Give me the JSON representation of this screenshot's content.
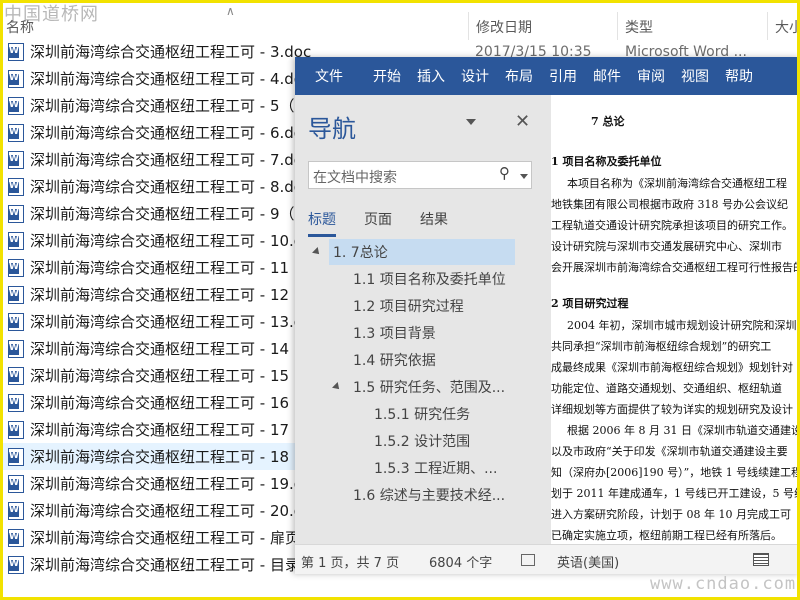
{
  "watermark_top": "中国道桥网",
  "watermark_bottom": "www.cndao.com",
  "explorer": {
    "columns": {
      "name": "名称",
      "date": "修改日期",
      "type": "类型",
      "size": "大小"
    },
    "files": [
      {
        "name": "深圳前海湾综合交通枢纽工程工可 - 3.doc",
        "date": "2017/3/15 10:35",
        "type": "Microsoft Word ..."
      },
      {
        "name": "深圳前海湾综合交通枢纽工程工可 - 4.doc"
      },
      {
        "name": "深圳前海湾综合交通枢纽工程工可 - 5（"
      },
      {
        "name": "深圳前海湾综合交通枢纽工程工可 - 6.doc"
      },
      {
        "name": "深圳前海湾综合交通枢纽工程工可 - 7.doc"
      },
      {
        "name": "深圳前海湾综合交通枢纽工程工可 - 8.doc"
      },
      {
        "name": "深圳前海湾综合交通枢纽工程工可 - 9（"
      },
      {
        "name": "深圳前海湾综合交通枢纽工程工可 - 10.doc"
      },
      {
        "name": "深圳前海湾综合交通枢纽工程工可 - 11"
      },
      {
        "name": "深圳前海湾综合交通枢纽工程工可 - 12"
      },
      {
        "name": "深圳前海湾综合交通枢纽工程工可 - 13.doc"
      },
      {
        "name": "深圳前海湾综合交通枢纽工程工可 - 14"
      },
      {
        "name": "深圳前海湾综合交通枢纽工程工可 - 15"
      },
      {
        "name": "深圳前海湾综合交通枢纽工程工可 - 16"
      },
      {
        "name": "深圳前海湾综合交通枢纽工程工可 - 17"
      },
      {
        "name": "深圳前海湾综合交通枢纽工程工可 - 18（"
      },
      {
        "name": "深圳前海湾综合交通枢纽工程工可 - 19.doc"
      },
      {
        "name": "深圳前海湾综合交通枢纽工程工可 - 20.doc"
      },
      {
        "name": "深圳前海湾综合交通枢纽工程工可 - 扉页"
      },
      {
        "name": "深圳前海湾综合交通枢纽工程工可 - 目录"
      }
    ]
  },
  "word": {
    "ribbon_tabs": [
      "文件",
      "开始",
      "插入",
      "设计",
      "布局",
      "引用",
      "邮件",
      "审阅",
      "视图",
      "帮助"
    ],
    "nav": {
      "title": "导航",
      "search_placeholder": "在文档中搜索",
      "tabs": [
        "标题",
        "页面",
        "结果"
      ],
      "items": [
        {
          "label": "1. 7总论",
          "selected": true,
          "expanded": true
        },
        {
          "label": "1.1 项目名称及委托单位"
        },
        {
          "label": "1.2 项目研究过程"
        },
        {
          "label": "1.3 项目背景"
        },
        {
          "label": "1.4 研究依据"
        },
        {
          "label": "1.5 研究任务、范围及...",
          "expanded": true
        },
        {
          "label": "1.5.1 研究任务"
        },
        {
          "label": "1.5.2 设计范围"
        },
        {
          "label": "1.5.3 工程近期、..."
        },
        {
          "label": "1.6 综述与主要技术经..."
        }
      ]
    },
    "doc_lines": [
      "7 总论",
      "1    项目名称及委托单位",
      "本项目名称为《深圳前海湾综合交通枢纽工程",
      "地铁集团有限公司根据市政府 318 号办公会议纪",
      "工程轨道交通设计研究院承担该项目的研究工作。",
      "设计研究院与深圳市交通发展研究中心、深圳市",
      "会开展深圳市前海湾综合交通枢纽工程可行性报告的",
      "2    项目研究过程",
      "2004 年初，深圳市城市规划设计研究院和深圳",
      "共同承担“深圳市前海枢纽综合规划”的研究工",
      "成最终成果《深圳市前海枢纽综合规划》规划针对",
      "功能定位、道路交通规划、交通组织、枢纽轨道",
      "详细规划等方面提供了较为详实的规划研究及设计",
      "根据 2006 年 8 月 31 日《深圳市轨道交通建设",
      "以及市政府“关于印发《深圳市轨道交通建设主要",
      "知（深府办[2006]190 号）”，地铁 1 号线续建工程设",
      "划于 2011 年建成通车，1 号线已开工建设，5 号线",
      "进入方案研究阶段，计划于 08 年 10 月完成工可",
      "已确定实施立项，枢纽前期工程已经有所落后。"
    ],
    "status": {
      "page": "第 1 页，共 7 页",
      "words": "6804 个字",
      "language": "英语(美国)"
    }
  }
}
